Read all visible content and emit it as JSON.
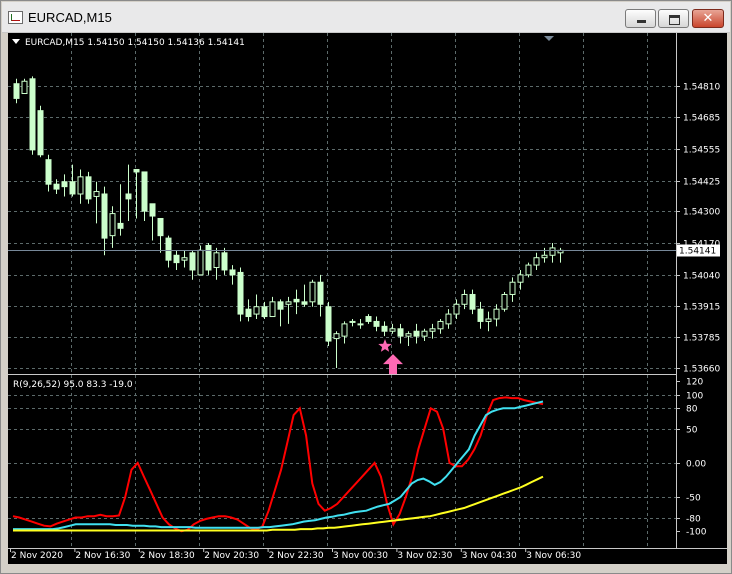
{
  "window": {
    "title": "EURCAD,M15",
    "minimize_icon": "minimize-icon",
    "maximize_icon": "maximize-icon",
    "close_icon": "close-icon",
    "close_glyph": "✕"
  },
  "chart_header": {
    "text": "EURCAD,M15  1.54150 1.54150 1.54136 1.54141",
    "menu_icon": "triangle-down-icon"
  },
  "colors": {
    "background": "#000000",
    "grid": "#5c6a6a",
    "axis": "#c8c8c8",
    "bull": "#000000",
    "bear": "#ccffcc",
    "candle_outline": "#ccffcc",
    "bid_line": "#778899",
    "red_line": "#ff0000",
    "cyan_line": "#40e0f0",
    "yellow_line": "#ffff20",
    "marker": "#ff69b4"
  },
  "chart_data": [
    {
      "type": "candlestick",
      "title": "EURCAD,M15  1.54150 1.54150 1.54136 1.54141",
      "ylim": [
        1.5366,
        1.5488
      ],
      "yticks": [
        "1.54810",
        "1.54685",
        "1.54555",
        "1.54425",
        "1.54300",
        "1.54170",
        "1.54040",
        "1.53915",
        "1.53785",
        "1.53660"
      ],
      "current_price": "1.54141",
      "ohlc": [
        [
          1.5482,
          1.5484,
          1.5474,
          1.5476
        ],
        [
          1.5478,
          1.5484,
          1.5478,
          1.5483
        ],
        [
          1.5484,
          1.5485,
          1.5453,
          1.5455
        ],
        [
          1.5471,
          1.5473,
          1.5452,
          1.5453
        ],
        [
          1.5451,
          1.5453,
          1.5438,
          1.5441
        ],
        [
          1.5441,
          1.5443,
          1.5437,
          1.5439
        ],
        [
          1.5442,
          1.5445,
          1.5436,
          1.544
        ],
        [
          1.5442,
          1.5449,
          1.5436,
          1.5437
        ],
        [
          1.5437,
          1.5447,
          1.5433,
          1.5444
        ],
        [
          1.5444,
          1.5446,
          1.5433,
          1.5435
        ],
        [
          1.5436,
          1.5442,
          1.5425,
          1.5438
        ],
        [
          1.5437,
          1.544,
          1.5412,
          1.5419
        ],
        [
          1.542,
          1.5432,
          1.5415,
          1.5429
        ],
        [
          1.5425,
          1.5441,
          1.542,
          1.5423
        ],
        [
          1.5437,
          1.5449,
          1.5426,
          1.5435
        ],
        [
          1.5447,
          1.5447,
          1.5427,
          1.5446
        ],
        [
          1.5446,
          1.5446,
          1.5426,
          1.543
        ],
        [
          1.5433,
          1.5433,
          1.5418,
          1.5428
        ],
        [
          1.5427,
          1.5427,
          1.5413,
          1.542
        ],
        [
          1.5419,
          1.542,
          1.5407,
          1.541
        ],
        [
          1.5412,
          1.5414,
          1.5406,
          1.5409
        ],
        [
          1.541,
          1.5414,
          1.5407,
          1.5411
        ],
        [
          1.5413,
          1.5414,
          1.5402,
          1.5406
        ],
        [
          1.5404,
          1.5416,
          1.5404,
          1.5414
        ],
        [
          1.5416,
          1.5417,
          1.5404,
          1.5406
        ],
        [
          1.5407,
          1.5415,
          1.5402,
          1.5413
        ],
        [
          1.5413,
          1.5415,
          1.5404,
          1.5406
        ],
        [
          1.5406,
          1.5408,
          1.54,
          1.5404
        ],
        [
          1.5405,
          1.5407,
          1.5385,
          1.5388
        ],
        [
          1.539,
          1.5394,
          1.5385,
          1.5387
        ],
        [
          1.5388,
          1.5396,
          1.5386,
          1.5391
        ],
        [
          1.5391,
          1.5393,
          1.5386,
          1.5387
        ],
        [
          1.5387,
          1.5395,
          1.5387,
          1.5393
        ],
        [
          1.5393,
          1.5394,
          1.5383,
          1.539
        ],
        [
          1.5392,
          1.5395,
          1.5384,
          1.5393
        ],
        [
          1.5394,
          1.5398,
          1.5388,
          1.5393
        ],
        [
          1.5393,
          1.54,
          1.5391,
          1.5392
        ],
        [
          1.5393,
          1.5402,
          1.5391,
          1.5401
        ],
        [
          1.5401,
          1.5404,
          1.5387,
          1.5392
        ],
        [
          1.5391,
          1.5393,
          1.5375,
          1.5377
        ],
        [
          1.5378,
          1.5381,
          1.5366,
          1.538
        ],
        [
          1.5379,
          1.5385,
          1.5376,
          1.5384
        ],
        [
          1.5385,
          1.5386,
          1.5383,
          1.5385
        ],
        [
          1.5384,
          1.5386,
          1.5382,
          1.5384
        ],
        [
          1.5387,
          1.5388,
          1.5384,
          1.5385
        ],
        [
          1.5385,
          1.5387,
          1.5381,
          1.5383
        ],
        [
          1.5383,
          1.5385,
          1.5379,
          1.5381
        ],
        [
          1.5381,
          1.5384,
          1.538,
          1.5382
        ],
        [
          1.5382,
          1.5384,
          1.5376,
          1.5379
        ],
        [
          1.5379,
          1.5381,
          1.5375,
          1.538
        ],
        [
          1.5381,
          1.5384,
          1.5376,
          1.5379
        ],
        [
          1.5379,
          1.5382,
          1.5377,
          1.5381
        ],
        [
          1.5381,
          1.5384,
          1.5378,
          1.5382
        ],
        [
          1.5382,
          1.5386,
          1.538,
          1.5385
        ],
        [
          1.5384,
          1.539,
          1.5382,
          1.5388
        ],
        [
          1.5388,
          1.5394,
          1.5386,
          1.5392
        ],
        [
          1.5392,
          1.5398,
          1.539,
          1.5396
        ],
        [
          1.5396,
          1.5398,
          1.5388,
          1.539
        ],
        [
          1.539,
          1.5393,
          1.5382,
          1.5385
        ],
        [
          1.5385,
          1.5389,
          1.5381,
          1.5386
        ],
        [
          1.5386,
          1.5392,
          1.5383,
          1.539
        ],
        [
          1.539,
          1.5397,
          1.5389,
          1.5396
        ],
        [
          1.5396,
          1.5403,
          1.5393,
          1.5401
        ],
        [
          1.5401,
          1.5406,
          1.5398,
          1.5404
        ],
        [
          1.5404,
          1.5409,
          1.5403,
          1.5408
        ],
        [
          1.5408,
          1.5413,
          1.5406,
          1.5411
        ],
        [
          1.5411,
          1.5415,
          1.5409,
          1.5412
        ],
        [
          1.5412,
          1.5417,
          1.5409,
          1.5415
        ],
        [
          1.5413,
          1.5415,
          1.5409,
          1.5414
        ]
      ],
      "marker_index": 46,
      "marker_icons": [
        "star-icon",
        "arrow-up-icon"
      ]
    },
    {
      "type": "line",
      "title": "R(9,26,52) 95.0 83.3 -19.0",
      "ylim": [
        -110,
        120
      ],
      "yticks": [
        {
          "label": "120",
          "value": 120
        },
        {
          "label": "100",
          "value": 100
        },
        {
          "label": "80",
          "value": 80
        },
        {
          "label": "50",
          "value": 50
        },
        {
          "label": "0.00",
          "value": 0
        },
        {
          "label": "-50",
          "value": -50
        },
        {
          "label": "-80",
          "value": -80
        },
        {
          "label": "-100",
          "value": -100
        }
      ],
      "series": [
        {
          "color": "#ff0000",
          "values": [
            -78,
            -80,
            -83,
            -86,
            -89,
            -92,
            -93,
            -89,
            -86,
            -83,
            -80,
            -80,
            -78,
            -78,
            -76,
            -78,
            -78,
            -77,
            -50,
            -10,
            0,
            -20,
            -40,
            -60,
            -80,
            -90,
            -96,
            -100,
            -98,
            -90,
            -85,
            -82,
            -80,
            -78,
            -78,
            -80,
            -83,
            -89,
            -95,
            -98,
            -93,
            -70,
            -40,
            -10,
            30,
            70,
            80,
            40,
            -30,
            -60,
            -70,
            -66,
            -60,
            -50,
            -40,
            -30,
            -20,
            -10,
            0,
            -20,
            -60,
            -90,
            -75,
            -50,
            -20,
            20,
            50,
            80,
            75,
            50,
            0,
            -5,
            -5,
            5,
            20,
            40,
            70,
            92,
            95,
            96,
            95,
            95,
            92,
            90,
            88,
            86
          ]
        },
        {
          "color": "#40e0f0",
          "values": [
            -97,
            -97,
            -97,
            -97,
            -97,
            -97,
            -97,
            -97,
            -96,
            -94,
            -92,
            -90,
            -90,
            -90,
            -90,
            -90,
            -90,
            -90,
            -91,
            -91,
            -91,
            -92,
            -92,
            -92,
            -93,
            -93,
            -94,
            -94,
            -94,
            -94,
            -94,
            -94,
            -95,
            -95,
            -95,
            -95,
            -95,
            -95,
            -95,
            -95,
            -95,
            -95,
            -95,
            -95,
            -94,
            -94,
            -93,
            -92,
            -91,
            -90,
            -88,
            -86,
            -85,
            -84,
            -82,
            -80,
            -79,
            -77,
            -76,
            -74,
            -72,
            -71,
            -70,
            -67,
            -64,
            -62,
            -60,
            -55,
            -50,
            -40,
            -30,
            -25,
            -23,
            -27,
            -32,
            -28,
            -20,
            -10,
            0,
            10,
            20,
            40,
            55,
            70,
            75,
            78,
            80,
            80,
            80,
            82,
            84,
            86,
            88,
            90
          ]
        },
        {
          "color": "#ffff20",
          "values": [
            -99,
            -99,
            -99,
            -99,
            -99,
            -99,
            -99,
            -99,
            -99,
            -99,
            -99,
            -99,
            -99,
            -99,
            -99,
            -99,
            -99,
            -99,
            -99,
            -99,
            -99,
            -99,
            -99,
            -99,
            -99,
            -99,
            -99,
            -99,
            -99,
            -99,
            -99,
            -99,
            -99,
            -99,
            -99,
            -99,
            -99,
            -99,
            -99,
            -99,
            -99,
            -99,
            -99,
            -99,
            -99,
            -99,
            -98,
            -98,
            -98,
            -98,
            -98,
            -97,
            -97,
            -97,
            -96,
            -96,
            -95,
            -95,
            -94,
            -93,
            -92,
            -91,
            -90,
            -89,
            -88,
            -87,
            -86,
            -85,
            -84,
            -83,
            -82,
            -81,
            -80,
            -79,
            -78,
            -76,
            -74,
            -72,
            -70,
            -68,
            -66,
            -63,
            -60,
            -57,
            -54,
            -51,
            -48,
            -45,
            -42,
            -39,
            -36,
            -32,
            -28,
            -24,
            -20
          ]
        }
      ],
      "xticks": [
        "2 Nov 2020",
        "2 Nov 16:30",
        "2 Nov 18:30",
        "2 Nov 20:30",
        "2 Nov 22:30",
        "3 Nov 00:30",
        "3 Nov 02:30",
        "3 Nov 04:30",
        "3 Nov 06:30"
      ]
    }
  ]
}
